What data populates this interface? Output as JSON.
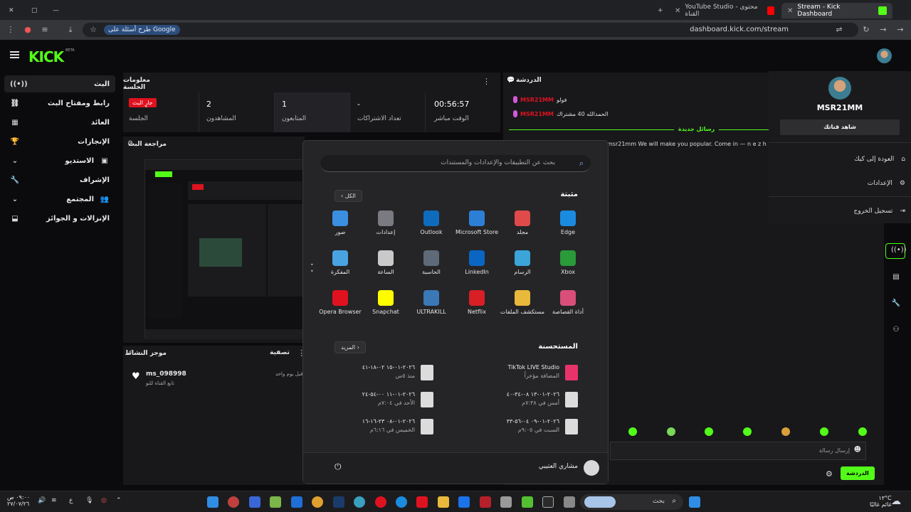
{
  "browser": {
    "tabs": [
      {
        "label": "Stream - Kick Dashboard",
        "active": true
      },
      {
        "label": "YouTube Studio - محتوى القناة",
        "active": false
      }
    ],
    "url": "dashboard.kick.com/stream",
    "google_search_label": "طرح أسئلة على Google"
  },
  "kick": {
    "logo": "KICK",
    "beta": "BETA"
  },
  "sidebar": {
    "items": [
      {
        "label": "البث",
        "icon": "broadcast-icon"
      },
      {
        "label": "رابط ومفتاح البث",
        "icon": "link-icon"
      },
      {
        "label": "العائد",
        "icon": "dashboard-icon"
      },
      {
        "label": "الإنجازات",
        "icon": "trophy-icon"
      },
      {
        "label": "الاستديو",
        "icon": "studio-icon"
      },
      {
        "label": "الإشراف",
        "icon": "wrench-icon"
      },
      {
        "label": "المجتمع",
        "icon": "community-icon"
      },
      {
        "label": "الإنزالات و الجوائز",
        "icon": "gift-icon"
      }
    ]
  },
  "session": {
    "title": "معلومات الجلسة",
    "live_badge": "جارٍ البث",
    "session_label": "الجلسة",
    "viewers_value": "2",
    "viewers_label": "المشاهدون",
    "followers_value": "1",
    "followers_label": "المتابعون",
    "subs_value": "-",
    "subs_label": "تعداد الاشتراكات",
    "time_value": "00:56:57",
    "time_label": "الوقت مباشر"
  },
  "preview": {
    "title": "مراجعة البث"
  },
  "activity": {
    "title": "موجز النشاط",
    "filter_label": "تصفية",
    "user": "ms_098998",
    "action": "تابع القناة للتو",
    "time": "قبل يوم واحد"
  },
  "chat": {
    "title": "الدردشة",
    "messages": [
      {
        "user": "MSR21MM",
        "text": "فولو"
      },
      {
        "user": "MSR21MM",
        "text": "الحمدالله 40 مشتراك"
      }
    ],
    "new_messages": "رسائل جديدة",
    "spam_text": "msr21mm We will make you popular. Come in — n e z h",
    "input_placeholder": "إرسال رسالة",
    "send_button": "الدردشة"
  },
  "profile_menu": {
    "username": "MSR21MM",
    "view_channel": "شاهد قناتك",
    "items": [
      {
        "label": "العودة إلى كيك",
        "icon": "home-icon"
      },
      {
        "label": "الإعدادات",
        "icon": "gear-icon"
      },
      {
        "label": "تسجيل الخروج",
        "icon": "logout-icon"
      }
    ]
  },
  "start_menu": {
    "search_placeholder": "بحث عن التطبيقات والإعدادات والمستندات",
    "pinned_title": "مثبتة",
    "all_button": "الكل",
    "pinned": [
      {
        "label": "Edge",
        "color": "#1b8be0"
      },
      {
        "label": "مجلد",
        "color": "#e04a4a"
      },
      {
        "label": "Microsoft Store",
        "color": "#2d7fd6"
      },
      {
        "label": "Outlook",
        "color": "#0f6cbd"
      },
      {
        "label": "إعدادات",
        "color": "#7a7a82"
      },
      {
        "label": "صور",
        "color": "#3a8fe0"
      },
      {
        "label": "Xbox",
        "color": "#2a9a3a"
      },
      {
        "label": "الرسام",
        "color": "#3ba4d8"
      },
      {
        "label": "LinkedIn",
        "color": "#0a66c2"
      },
      {
        "label": "الحاسبة",
        "color": "#5e6a78"
      },
      {
        "label": "الساعة",
        "color": "#c9c9c9"
      },
      {
        "label": "المفكرة",
        "color": "#49a3e0"
      },
      {
        "label": "أداة القصاصة",
        "color": "#d94f7a"
      },
      {
        "label": "مستكشف الملفات",
        "color": "#e8b93b"
      },
      {
        "label": "Netflix",
        "color": "#d81f26"
      },
      {
        "label": "ULTRAKILL",
        "color": "#3a78b8"
      },
      {
        "label": "Snapchat",
        "color": "#fffc00"
      },
      {
        "label": "Opera Browser",
        "color": "#e0121f"
      }
    ],
    "recommended_title": "المستحسنة",
    "more_button": "المزيد",
    "recommended": [
      {
        "title": "TikTok LIVE Studio",
        "sub": "المضافة مؤخراً"
      },
      {
        "title": "٢٠٢٦-٠١-١٥ ٠٢-١٨-٤١",
        "sub": "منذ ٥س"
      },
      {
        "title": "٢٠٢٦-٠١-١٣ ٠٨-٣٤-٤٠",
        "sub": "أمس في ٧:٣٨م"
      },
      {
        "title": "٢٠٢٦-٠١-١١ ٠٠-٥٤-٢٤",
        "sub": "الأحد في ٧:٠٤م"
      },
      {
        "title": "٢٠٢٦-٠١-٠٩ ٠٤-٥٦-٣٣",
        "sub": "السبت في ٩:٠٥م"
      },
      {
        "title": "٢٠٢٦-٠١-٠٨ ٢٣-١٦-١٦",
        "sub": "الخميس في ٦:١٦م"
      }
    ],
    "user_name": "مشاري العتيبي"
  },
  "taskbar": {
    "search_label": "بحث",
    "weather_temp": "١٣°C",
    "weather_desc": "غائم غالبًا",
    "time": "٠٩:٠٠ ص",
    "date": "٢٧/٠٧/٢٦",
    "lang": "ع"
  },
  "colors": {
    "kick_green": "#53fc18",
    "live_red": "#e0121f",
    "panel_bg": "#18181b",
    "page_bg": "#0b0b0d"
  }
}
